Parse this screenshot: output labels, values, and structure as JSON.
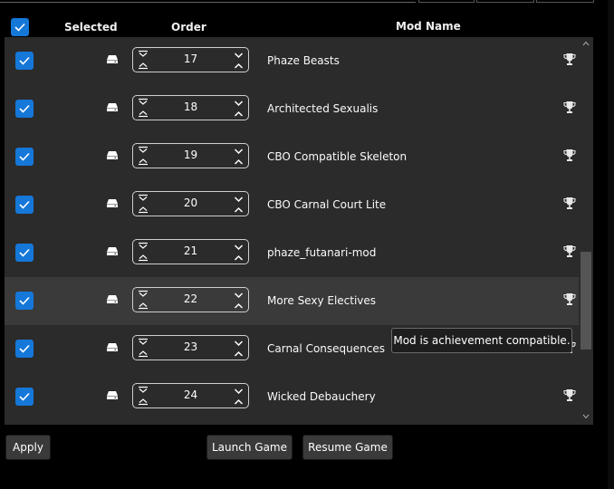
{
  "header": {
    "selected_label": "Selected",
    "order_label": "Order",
    "mod_name_label": "Mod Name"
  },
  "mods": [
    {
      "order": "17",
      "name": "Phaze Beasts",
      "highlighted": false
    },
    {
      "order": "18",
      "name": "Architected Sexualis",
      "highlighted": false
    },
    {
      "order": "19",
      "name": "CBO Compatible Skeleton",
      "highlighted": false
    },
    {
      "order": "20",
      "name": "CBO Carnal Court Lite",
      "highlighted": false
    },
    {
      "order": "21",
      "name": "phaze_futanari-mod",
      "highlighted": false
    },
    {
      "order": "22",
      "name": "More Sexy Electives",
      "highlighted": true
    },
    {
      "order": "23",
      "name": "Carnal Consequences",
      "highlighted": false
    },
    {
      "order": "24",
      "name": "Wicked Debauchery",
      "highlighted": false
    }
  ],
  "tooltip": {
    "text": "Mod is achievement compatible."
  },
  "buttons": {
    "apply": "Apply",
    "launch": "Launch Game",
    "resume": "Resume Game"
  },
  "icons": {
    "checkbox": "checkmark-icon",
    "source": "hard-drive-icon",
    "move_to_edges": "move-top-bottom-icon",
    "step": "chevron-up-down-icon",
    "achievement": "trophy-icon"
  },
  "colors": {
    "accent": "#1577d8",
    "panel": "#2b2b2b",
    "row_hover": "#3a3a3a",
    "background": "#000000"
  }
}
